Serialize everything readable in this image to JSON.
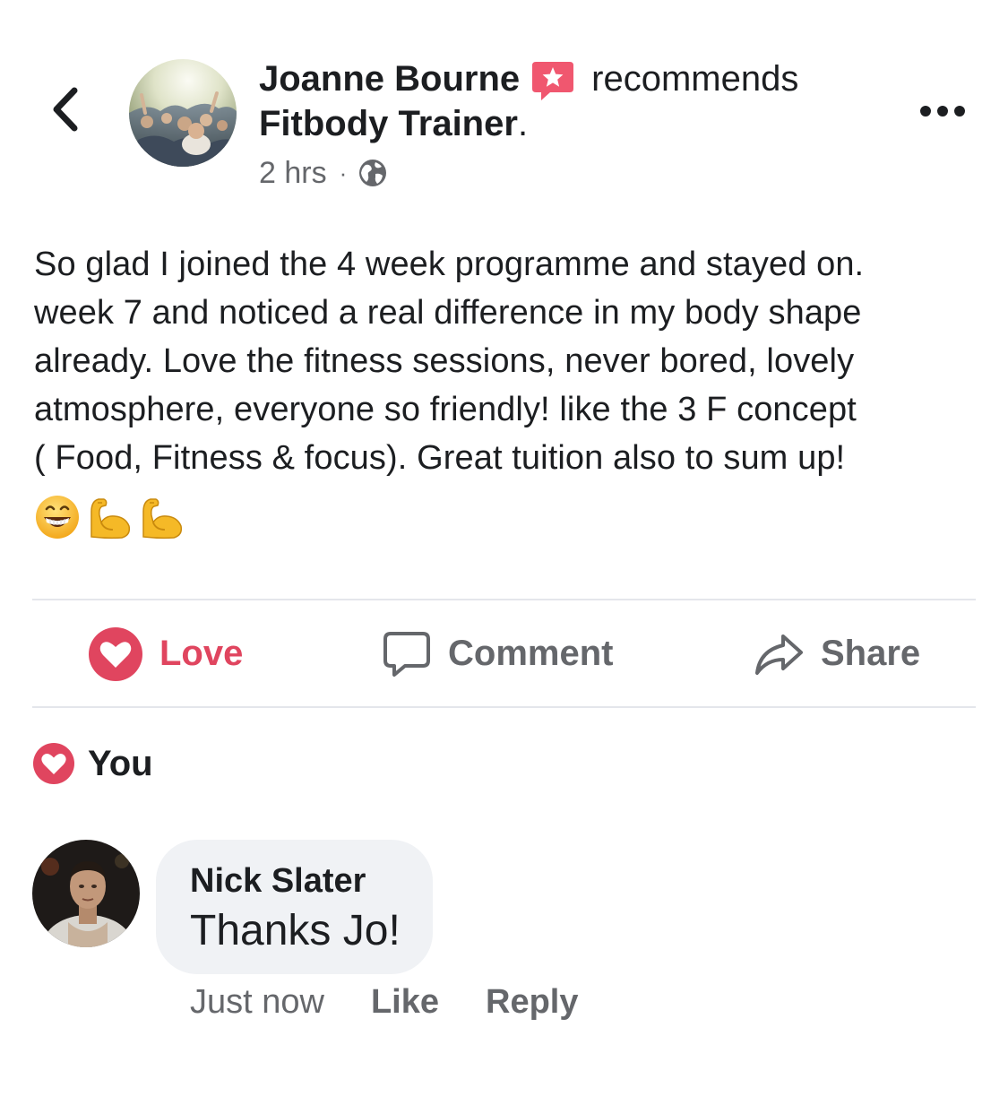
{
  "post": {
    "author": "Joanne Bourne",
    "action_text": "recommends",
    "page_name": "Fitbody Trainer",
    "page_name_suffix": ".",
    "timestamp": "2 hrs",
    "separator": "·",
    "privacy_icon": "globe-icon",
    "body": "So glad I joined the 4 week programme and stayed on.\nweek 7 and noticed a real difference in my body shape\nalready. Love the fitness sessions, never bored, lovely\natmosphere, everyone so friendly! like the 3 F concept\n( Food, Fitness & focus). Great tuition also to sum up!",
    "emojis": [
      "grinning-face-emoji",
      "flexed-biceps-emoji",
      "flexed-biceps-emoji"
    ]
  },
  "header": {
    "back_icon": "chevron-left-icon",
    "more_icon": "more-dots-icon",
    "badge_icon": "recommendation-star-icon"
  },
  "actions": {
    "love_label": "Love",
    "comment_label": "Comment",
    "share_label": "Share"
  },
  "reactions": {
    "summary_label": "You",
    "icon": "heart-reaction-icon"
  },
  "comments": [
    {
      "author": "Nick Slater",
      "text": "Thanks Jo!",
      "time": "Just now",
      "like_label": "Like",
      "reply_label": "Reply"
    }
  ],
  "colors": {
    "love_red": "#e0455f",
    "secondary_text": "#65676b",
    "bubble_bg": "#f0f2f5",
    "divider": "#e4e6eb"
  }
}
